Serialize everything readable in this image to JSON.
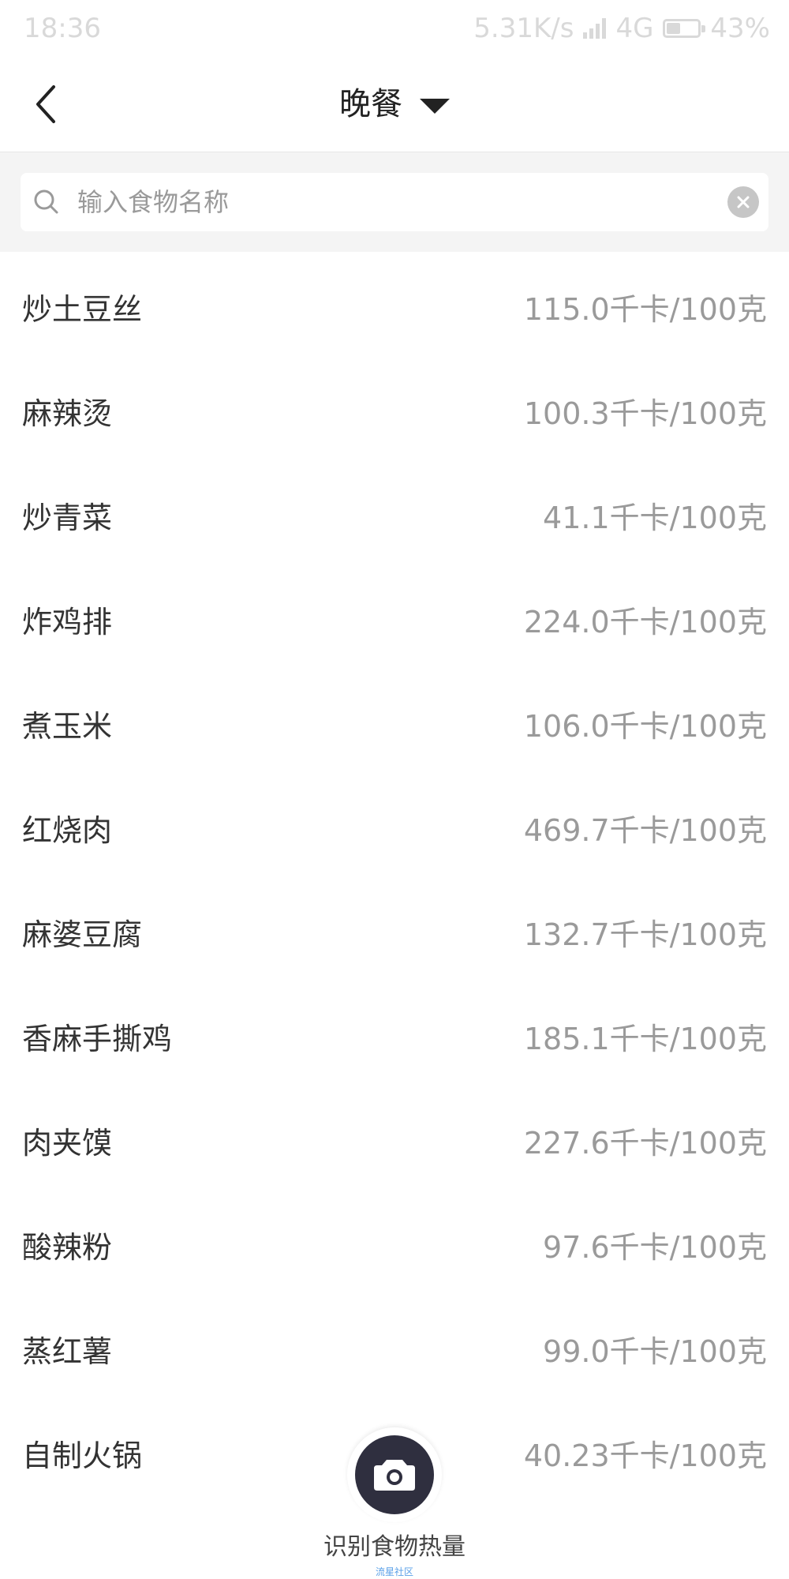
{
  "status_bar": {
    "time": "18:36",
    "speed": "5.31K/s",
    "network": "4G",
    "battery": "43%",
    "battery_level": 0.43
  },
  "header": {
    "title": "晚餐"
  },
  "search": {
    "placeholder": "输入食物名称",
    "value": ""
  },
  "foods": [
    {
      "name": "炒土豆丝",
      "calories": "115.0千卡/100克"
    },
    {
      "name": "麻辣烫",
      "calories": "100.3千卡/100克"
    },
    {
      "name": "炒青菜",
      "calories": "41.1千卡/100克"
    },
    {
      "name": "炸鸡排",
      "calories": "224.0千卡/100克"
    },
    {
      "name": "煮玉米",
      "calories": "106.0千卡/100克"
    },
    {
      "name": "红烧肉",
      "calories": "469.7千卡/100克"
    },
    {
      "name": "麻婆豆腐",
      "calories": "132.7千卡/100克"
    },
    {
      "name": "香麻手撕鸡",
      "calories": "185.1千卡/100克"
    },
    {
      "name": "肉夹馍",
      "calories": "227.6千卡/100克"
    },
    {
      "name": "酸辣粉",
      "calories": "97.6千卡/100克"
    },
    {
      "name": "蒸红薯",
      "calories": "99.0千卡/100克"
    },
    {
      "name": "自制火锅",
      "calories": "40.23千卡/100克"
    }
  ],
  "camera": {
    "label": "识别食物热量",
    "icon": "camera-icon"
  },
  "watermark": "流星社区",
  "colors": {
    "camera_bg": "#2f2f3f",
    "text_primary": "#333333",
    "text_secondary": "#9a9a9a",
    "search_bg": "#f4f4f4"
  }
}
